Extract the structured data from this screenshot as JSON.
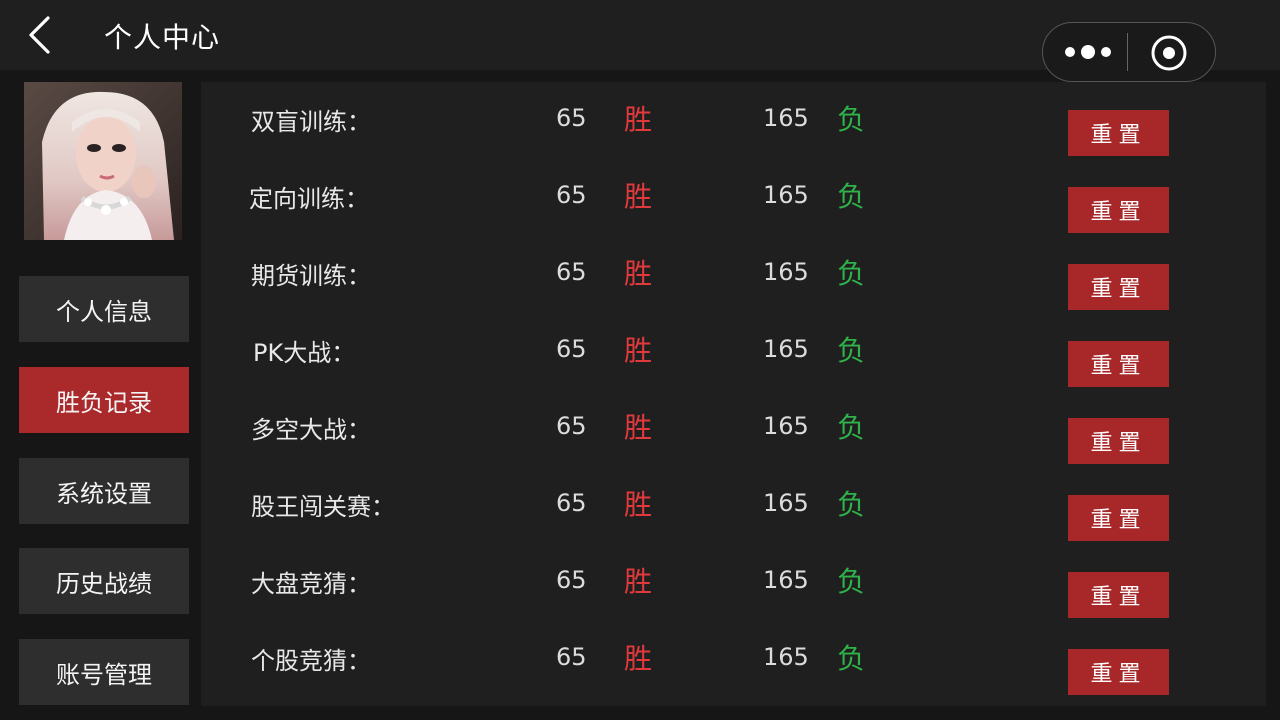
{
  "header": {
    "title": "个人中心",
    "back_icon": "chevron-left-icon",
    "more_icon": "more-dots-icon",
    "close_icon": "target-circle-icon"
  },
  "sidebar": {
    "items": [
      {
        "label": "个人信息",
        "active": false
      },
      {
        "label": "胜负记录",
        "active": true
      },
      {
        "label": "系统设置",
        "active": false
      },
      {
        "label": "历史战绩",
        "active": false
      },
      {
        "label": "账号管理",
        "active": false
      }
    ]
  },
  "records": {
    "rows": [
      {
        "name": "双盲训练：",
        "wins": "65",
        "win_tag": "胜",
        "losses": "165",
        "loss_tag": "负",
        "reset_label": "重置"
      },
      {
        "name": "定向训练：",
        "wins": "65",
        "win_tag": "胜",
        "losses": "165",
        "loss_tag": "负",
        "reset_label": "重置"
      },
      {
        "name": "期货训练：",
        "wins": "65",
        "win_tag": "胜",
        "losses": "165",
        "loss_tag": "负",
        "reset_label": "重置"
      },
      {
        "name": "PK大战：",
        "wins": "65",
        "win_tag": "胜",
        "losses": "165",
        "loss_tag": "负",
        "reset_label": "重置"
      },
      {
        "name": "多空大战：",
        "wins": "65",
        "win_tag": "胜",
        "losses": "165",
        "loss_tag": "负",
        "reset_label": "重置"
      },
      {
        "name": "股王闯关赛：",
        "wins": "65",
        "win_tag": "胜",
        "losses": "165",
        "loss_tag": "负",
        "reset_label": "重置"
      },
      {
        "name": "大盘竞猜：",
        "wins": "65",
        "win_tag": "胜",
        "losses": "165",
        "loss_tag": "负",
        "reset_label": "重置"
      },
      {
        "name": "个股竞猜：",
        "wins": "65",
        "win_tag": "胜",
        "losses": "165",
        "loss_tag": "负",
        "reset_label": "重置"
      }
    ]
  },
  "colors": {
    "accent": "#aa2a2c",
    "win": "#e03a3c",
    "loss": "#2fb24a",
    "background": "#161616",
    "panel": "#1f1f1f"
  }
}
